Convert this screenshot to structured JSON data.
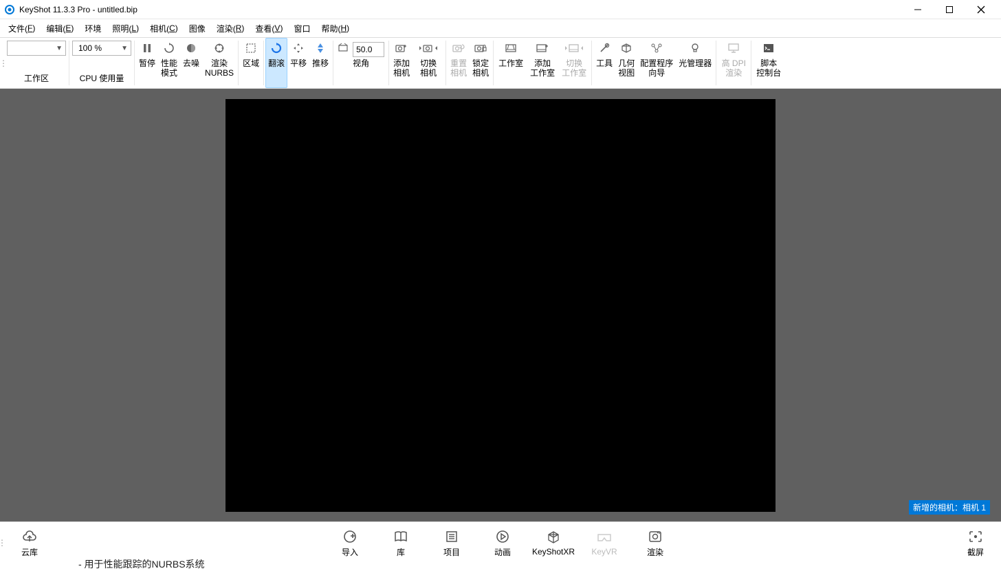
{
  "titlebar": {
    "title": "KeyShot 11.3.3 Pro  - untitled.bip"
  },
  "menu": {
    "items": [
      {
        "label": "文件",
        "key": "F"
      },
      {
        "label": "编辑",
        "key": "E"
      },
      {
        "label": "环境",
        "key": ""
      },
      {
        "label": "照明",
        "key": "L"
      },
      {
        "label": "相机",
        "key": "C"
      },
      {
        "label": "图像",
        "key": ""
      },
      {
        "label": "渲染",
        "key": "R"
      },
      {
        "label": "查看",
        "key": "V"
      },
      {
        "label": "窗口",
        "key": ""
      },
      {
        "label": "帮助",
        "key": "H"
      }
    ]
  },
  "toolbar": {
    "workspace_combo": "",
    "workspace_label": "工作区",
    "cpu_combo": "100 %",
    "cpu_label": "CPU 使用量",
    "pause": "暂停",
    "perf_mode_line1": "性能",
    "perf_mode_line2": "模式",
    "denoise": "去噪",
    "nurbs_line1": "渲染",
    "nurbs_line2": "NURBS",
    "region": "区域",
    "tumble": "翻滚",
    "pan": "平移",
    "dolly": "推移",
    "fov_value": "50.0",
    "perspective": "视角",
    "addcam_line1": "添加",
    "addcam_line2": "相机",
    "switchcam_line1": "切换",
    "switchcam_line2": "相机",
    "resetcam_line1": "重置",
    "resetcam_line2": "相机",
    "lockcam_line1": "锁定",
    "lockcam_line2": "相机",
    "studio": "工作室",
    "addstudio_line1": "添加",
    "addstudio_line2": "工作室",
    "switchstudio_line1": "切换",
    "switchstudio_line2": "工作室",
    "tools": "工具",
    "geoview_line1": "几何",
    "geoview_line2": "视图",
    "configurator_line1": "配置程序",
    "configurator_line2": "向导",
    "lightmgr": "光管理器",
    "hidpi_line1": "高 DPI",
    "hidpi_line2": "渲染",
    "script_line1": "脚本",
    "script_line2": "控制台"
  },
  "viewport": {
    "camera_badge": "新增的相机：相机 1"
  },
  "bottombar": {
    "cloud": "云库",
    "import": "导入",
    "library": "库",
    "project": "项目",
    "animation": "动画",
    "keyshotxr": "KeyShotXR",
    "keyvr": "KeyVR",
    "render": "渲染",
    "screenshot": "截屏"
  },
  "footer_cut": "- 用于性能跟踪的NURBS系统"
}
